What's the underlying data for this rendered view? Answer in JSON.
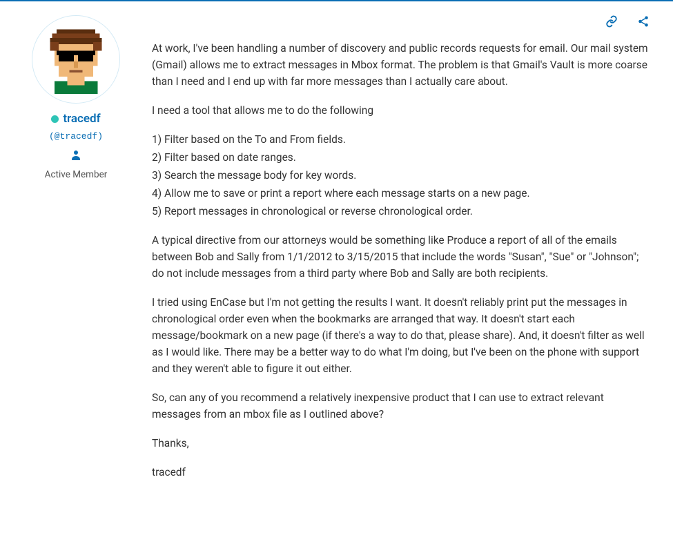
{
  "user": {
    "displayName": "tracedf",
    "handle": "(@tracedf)",
    "role": "Active Member",
    "online": true
  },
  "post": {
    "para1": "At work, I've been handling a number of discovery and public records requests for email. Our mail system (Gmail) allows me to extract messages in Mbox format. The problem is that Gmail's Vault is more coarse than I need and I end up with far more messages than I actually care about.",
    "para2": "I need a tool that allows me to do the following",
    "listItems": [
      "1) Filter based on the To and From fields.",
      "2) Filter based on date ranges.",
      "3) Search the message body for key words.",
      "4) Allow me to save or print a report where each message starts on a new page.",
      "5) Report messages in chronological or reverse chronological order."
    ],
    "para3": "A typical directive from our attorneys would be something like Produce a report of all of the emails between Bob and Sally from 1/1/2012 to 3/15/2015 that include the words \"Susan\", \"Sue\" or \"Johnson\"; do not include messages from a third party where Bob and Sally are both recipients.",
    "para4": "I tried using EnCase but I'm not getting the results I want. It doesn't reliably print put the messages in chronological order even when the bookmarks are arranged that way. It doesn't start each message/bookmark on a new page (if there's a way to do that, please share). And, it doesn't filter as well as I would like. There may be a better way to do what I'm doing, but I've been on the phone with support and they weren't able to figure it out either.",
    "para5": "So, can any of you recommend a relatively inexpensive product that I can use to extract relevant messages from an mbox file as I outlined above?",
    "para6": "Thanks,",
    "para7": "tracedf"
  }
}
